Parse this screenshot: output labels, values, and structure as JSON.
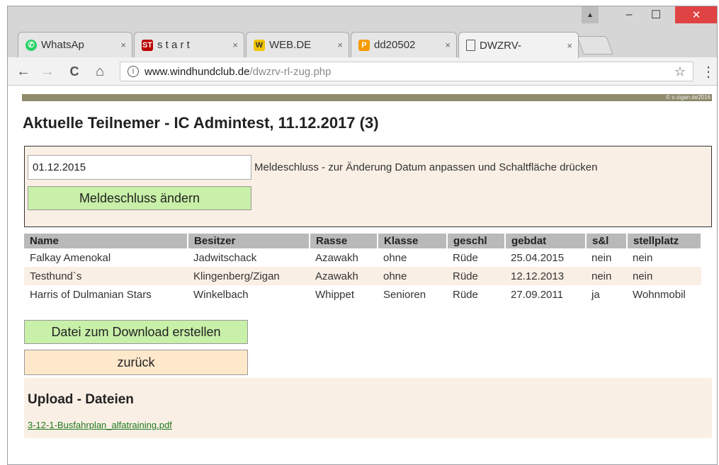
{
  "browser": {
    "tabs": [
      {
        "title": "WhatsAp",
        "icon": "whatsapp-icon",
        "close": "×"
      },
      {
        "title": "s t a r t",
        "icon": "stz-icon",
        "close": "×"
      },
      {
        "title": "WEB.DE",
        "icon": "webde-icon",
        "close": "×"
      },
      {
        "title": "dd20502",
        "icon": "pma-icon",
        "close": "×"
      },
      {
        "title": "DWZRV-",
        "icon": "page-icon",
        "close": "×"
      }
    ],
    "url_host": "www.windhundclub.de",
    "url_path": "/dwzrv-rl-zug.php",
    "nav": {
      "back": "←",
      "forward": "→",
      "reload": "C",
      "home": "⌂"
    },
    "star": "☆",
    "menu": "⋮",
    "window_controls": {
      "minimize": "–",
      "maximize": "☐",
      "close": "✕",
      "user": "▲"
    }
  },
  "page": {
    "copyright": "© s-zigan.de2016",
    "title": "Aktuelle Teilnemer - IC Admintest, 11.12.2017 (3)",
    "deadline_input_value": "01.12.2015",
    "deadline_hint": "Meldeschluss - zur Änderung Datum anpassen und Schaltfläche drücken",
    "deadline_button": "Meldeschluss ändern",
    "table": {
      "headers": [
        "Name",
        "Besitzer",
        "Rasse",
        "Klasse",
        "geschl",
        "gebdat",
        "s&l",
        "stellplatz"
      ],
      "rows": [
        [
          "Falkay Amenokal",
          "Jadwitschack",
          "Azawakh",
          "ohne",
          "Rüde",
          "25.04.2015",
          "nein",
          "nein"
        ],
        [
          "Testhund`s",
          "Klingenberg/Zigan",
          "Azawakh",
          "ohne",
          "Rüde",
          "12.12.2013",
          "nein",
          "nein"
        ],
        [
          "Harris of Dulmanian Stars",
          "Winkelbach",
          "Whippet",
          "Senioren",
          "Rüde",
          "27.09.2011",
          "ja",
          "Wohnmobil"
        ]
      ]
    },
    "download_button": "Datei zum Download erstellen",
    "back_button": "zurück",
    "upload_title": "Upload - Dateien",
    "upload_file": "3-12-1-Busfahrplan_alfatraining.pdf"
  },
  "colors": {
    "bar": "#8e8a6c",
    "panel": "#faefe5",
    "green_button": "#c8f0a8",
    "peach_button": "#fde8cc",
    "link": "#1f7a1f"
  }
}
